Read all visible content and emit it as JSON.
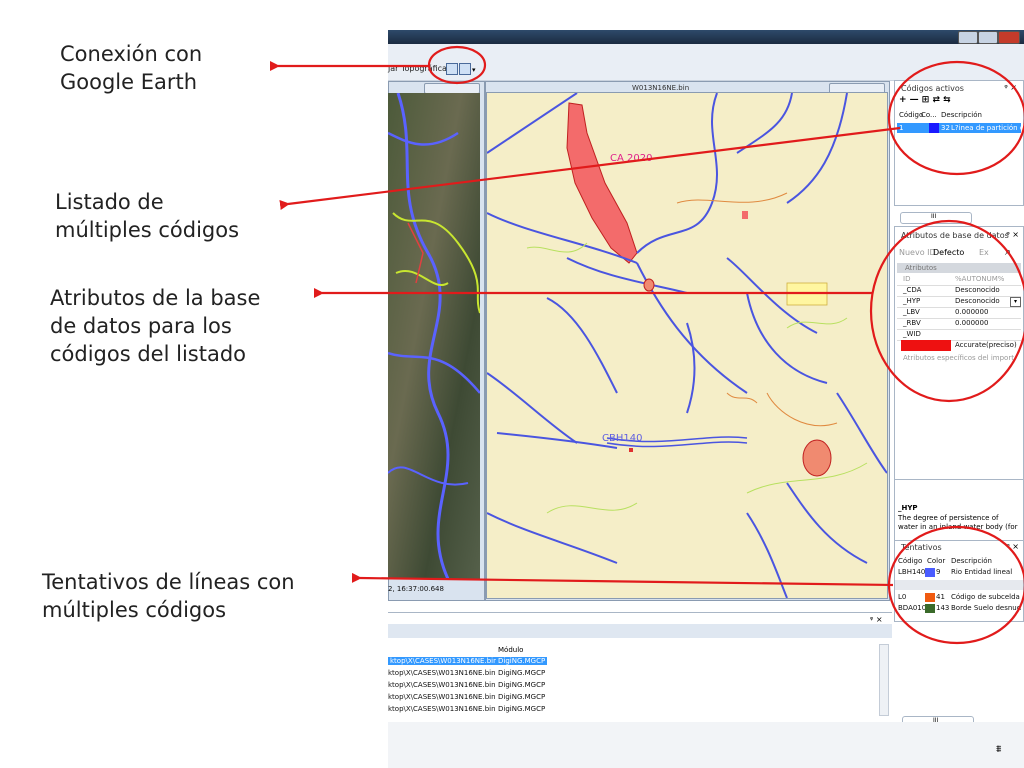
{
  "callouts": {
    "google_earth": "Conexión con\nGoogle Earth",
    "code_list": "Listado de\nmúltiples códigos",
    "db_attributes": "Atributos de la base\nde datos para los\ncódigos del listado",
    "tentatives": "Tentativos de líneas con\nmúltiples códigos"
  },
  "toolbar": {
    "label": "jar Topográficas"
  },
  "map_window": {
    "title": "W013N16NE.bin",
    "labels": {
      "ca": "CA 2020",
      "bh": "CBH140"
    }
  },
  "status": {
    "time": "2, 16:37:00.648"
  },
  "active_codes": {
    "title": "Códigos activos",
    "pin": "ᵠ ×",
    "tools": "+ — ⊞ ⇄ ⇆",
    "headers": [
      "Código",
      "Co...",
      "Descripción"
    ],
    "rows": [
      {
        "code": "1",
        "color_num": "32",
        "desc": "L?inea de partición d",
        "swatch": "#1a1aff"
      }
    ]
  },
  "db_attrs": {
    "scroll_label": "III",
    "title": "Atributos de base de datos",
    "pin": "ᵠ ×",
    "tools": {
      "new_id": "Nuevo ID",
      "default": "Defecto",
      "ex": "Ex"
    },
    "section": "Atributos",
    "rows": [
      {
        "key": "ID",
        "value": "%AUTONUM%"
      },
      {
        "key": "_CDA",
        "value": "Desconocido"
      },
      {
        "key": "_HYP",
        "value": "Desconocido"
      },
      {
        "key": "_LBV",
        "value": "0.000000"
      },
      {
        "key": "_RBV",
        "value": "0.000000"
      },
      {
        "key": "_WID",
        "value": ""
      },
      {
        "key": "",
        "value": "Accurate(preciso)"
      }
    ],
    "footer": "Atributos específicos del import",
    "desc_title": "_HYP",
    "desc_text": "The degree of persistence of water in an inland water body (for"
  },
  "tentatives": {
    "title": "Tentativos",
    "pin": "ᵠ ×",
    "headers": [
      "Código",
      "Color",
      "Descripción"
    ],
    "rows": [
      {
        "code": "LBH140",
        "num": "9",
        "desc": "Rio Entidad lineal",
        "swatch": "#4a5cff"
      },
      {
        "code": "L0",
        "num": "41",
        "desc": "Código de subcelda",
        "swatch": "#f05a10"
      },
      {
        "code": "BDA010",
        "num": "143",
        "desc": "Borde Suelo desnud",
        "swatch": "#3a6a2a"
      }
    ]
  },
  "log": {
    "pin": "ᵠ ×",
    "module_header": "Módulo",
    "rows": [
      {
        "path": "ktop\\X\\CASES\\W013N16NE.bin",
        "module": "DigiNG.MGCP"
      },
      {
        "path": "ktop\\X\\CASES\\W013N16NE.bin",
        "module": "DigiNG.MGCP"
      },
      {
        "path": "ktop\\X\\CASES\\W013N16NE.bin",
        "module": "DigiNG.MGCP"
      },
      {
        "path": "ktop\\X\\CASES\\W013N16NE.bin",
        "module": "DigiNG.MGCP"
      },
      {
        "path": "ktop\\X\\CASES\\W013N16NE.bin",
        "module": "DigiNG.MGCP"
      }
    ],
    "scroll_label": "III"
  },
  "colors": {
    "callout_arrow": "#e11b1b",
    "map_bg": "#f5eec8",
    "river": "#4a55e0",
    "selection": "#3399ff"
  }
}
